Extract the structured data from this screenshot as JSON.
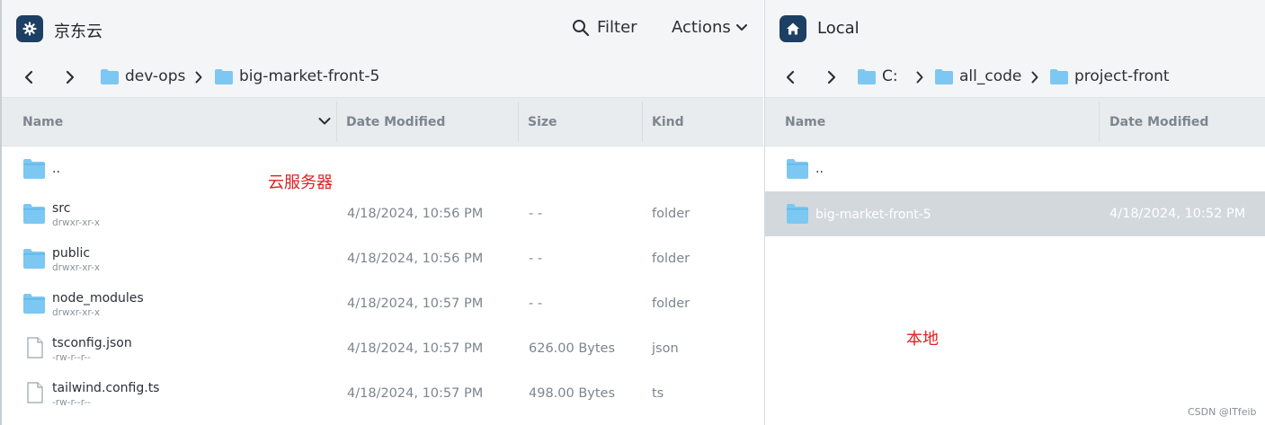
{
  "left_pane": {
    "host_name": "京东云",
    "host_icon": "gear-icon",
    "filter_label": "Filter",
    "actions_label": "Actions",
    "breadcrumb": [
      "dev-ops",
      "big-market-front-5"
    ],
    "columns": {
      "name": "Name",
      "date_modified": "Date Modified",
      "size": "Size",
      "kind": "Kind"
    },
    "rows": [
      {
        "name": "..",
        "perm": "",
        "date": "",
        "size": "",
        "kind": "",
        "type": "folder"
      },
      {
        "name": "src",
        "perm": "drwxr-xr-x",
        "date": "4/18/2024, 10:56 PM",
        "size": "- -",
        "kind": "folder",
        "type": "folder"
      },
      {
        "name": "public",
        "perm": "drwxr-xr-x",
        "date": "4/18/2024, 10:56 PM",
        "size": "- -",
        "kind": "folder",
        "type": "folder"
      },
      {
        "name": "node_modules",
        "perm": "drwxr-xr-x",
        "date": "4/18/2024, 10:57 PM",
        "size": "- -",
        "kind": "folder",
        "type": "folder"
      },
      {
        "name": "tsconfig.json",
        "perm": "-rw-r--r--",
        "date": "4/18/2024, 10:57 PM",
        "size": "626.00 Bytes",
        "kind": "json",
        "type": "file"
      },
      {
        "name": "tailwind.config.ts",
        "perm": "-rw-r--r--",
        "date": "4/18/2024, 10:57 PM",
        "size": "498.00 Bytes",
        "kind": "ts",
        "type": "file"
      }
    ],
    "annotation": "云服务器"
  },
  "right_pane": {
    "host_name": "Local",
    "host_icon": "home-icon",
    "breadcrumb": [
      "C:",
      "all_code",
      "project-front"
    ],
    "columns": {
      "name": "Name",
      "date_modified": "Date Modified"
    },
    "rows": [
      {
        "name": "..",
        "date": "",
        "selected": false
      },
      {
        "name": "big-market-front-5",
        "date": "4/18/2024, 10:52 PM",
        "selected": true
      }
    ],
    "annotation": "本地"
  },
  "watermark": "CSDN @ITfeib",
  "colors": {
    "folder": "#7cc8f2",
    "folder_tab": "#5fb7ea",
    "host_badge": "#1d3f63",
    "annotation": "#e02020",
    "selected_row": "#d3d8dd"
  }
}
